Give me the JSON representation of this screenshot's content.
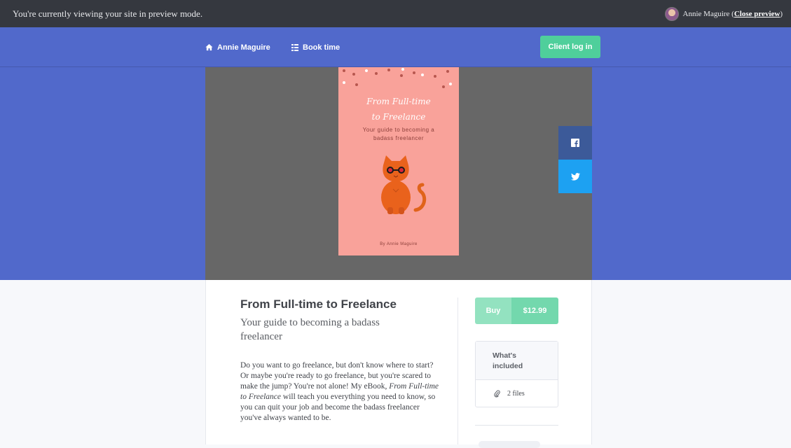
{
  "preview_bar": {
    "message": "You're currently viewing your site in preview mode.",
    "user_name": "Annie Maguire (",
    "close_label": "Close preview",
    "close_paren": ")"
  },
  "nav": {
    "home_label": "Annie Maguire",
    "book_label": "Book time",
    "login_label": "Client log in"
  },
  "cover": {
    "title_line1": "From Full-time",
    "title_line2": "to Freelance",
    "subtitle_line1": "Your guide to becoming a",
    "subtitle_line2": "badass freelancer",
    "author": "By Annie Maguire"
  },
  "product": {
    "title": "From Full-time to Freelance",
    "subtitle": "Your guide to becoming a badass freelancer",
    "desc_part1": "Do you want to go freelance, but don't know where to start? Or maybe you're ready to go freelance, but you're scared to make the jump? You're not alone! My eBook, ",
    "desc_italic": "From Full-time to Freelance",
    "desc_part2": " will teach you everything you need to know, so you can quit your job and become the badass freelancer you've always wanted to be."
  },
  "purchase": {
    "buy_label": "Buy",
    "price": "$12.99",
    "included_title_line1": "What's",
    "included_title_line2": "included",
    "files_count": "2 files"
  },
  "colors": {
    "nav_bg": "#5169cb",
    "accent_green": "#4fcf9b",
    "facebook": "#3c5a99",
    "twitter": "#1da1f2",
    "cover_bg": "#f9a29a"
  },
  "icons": {
    "home": "home-icon",
    "book": "list-icon",
    "facebook": "facebook-icon",
    "twitter": "twitter-icon",
    "attachment": "paperclip-icon"
  }
}
